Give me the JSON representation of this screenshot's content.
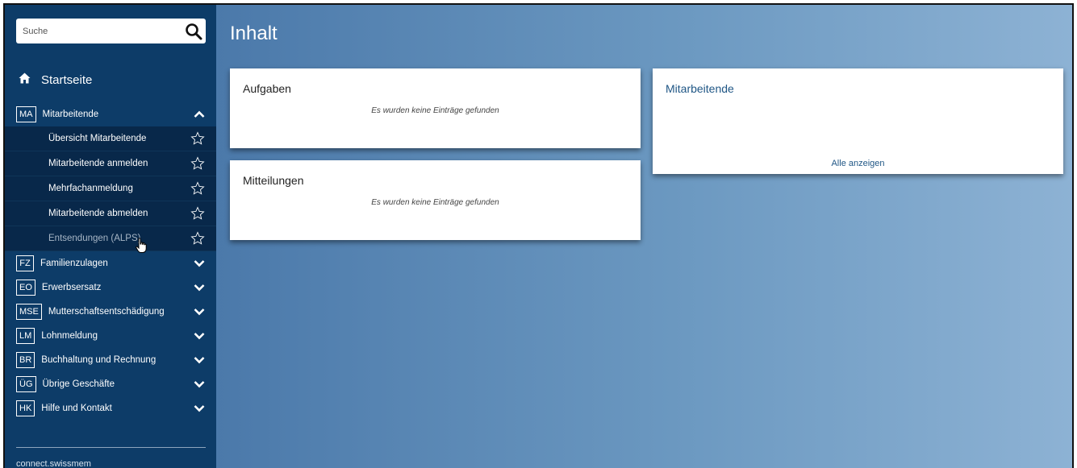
{
  "sidebar": {
    "search": {
      "placeholder": "Suche",
      "icon": "search-icon"
    },
    "home": {
      "label": "Startseite",
      "icon": "home-icon"
    },
    "sections": [
      {
        "abbr": "MA",
        "label": "Mitarbeitende",
        "expanded": true,
        "items": [
          {
            "label": "Übersicht Mitarbeitende"
          },
          {
            "label": "Mitarbeitende anmelden"
          },
          {
            "label": "Mehrfachanmeldung"
          },
          {
            "label": "Mitarbeitende abmelden"
          },
          {
            "label": "Entsendungen (ALPS)"
          }
        ]
      },
      {
        "abbr": "FZ",
        "label": "Familienzulagen",
        "expanded": false
      },
      {
        "abbr": "EO",
        "label": "Erwerbsersatz",
        "expanded": false
      },
      {
        "abbr": "MSE",
        "label": "Mutterschaftsentschädigung",
        "expanded": false
      },
      {
        "abbr": "LM",
        "label": "Lohnmeldung",
        "expanded": false
      },
      {
        "abbr": "BR",
        "label": "Buchhaltung und Rechnung",
        "expanded": false
      },
      {
        "abbr": "ÜG",
        "label": "Übrige Geschäfte",
        "expanded": false
      },
      {
        "abbr": "HK",
        "label": "Hilfe und Kontakt",
        "expanded": false
      }
    ],
    "footer": "connect.swissmem"
  },
  "main": {
    "title": "Inhalt",
    "cards": {
      "aufgaben": {
        "title": "Aufgaben",
        "empty": "Es wurden keine Einträge gefunden"
      },
      "mitteilungen": {
        "title": "Mitteilungen",
        "empty": "Es wurden keine Einträge gefunden"
      },
      "mitarbeitende": {
        "title": "Mitarbeitende",
        "link": "Alle anzeigen"
      }
    }
  },
  "colors": {
    "sidebar_bg": "#0d3c68",
    "submenu_bg": "#08284a",
    "accent_blue": "#1f5685"
  }
}
